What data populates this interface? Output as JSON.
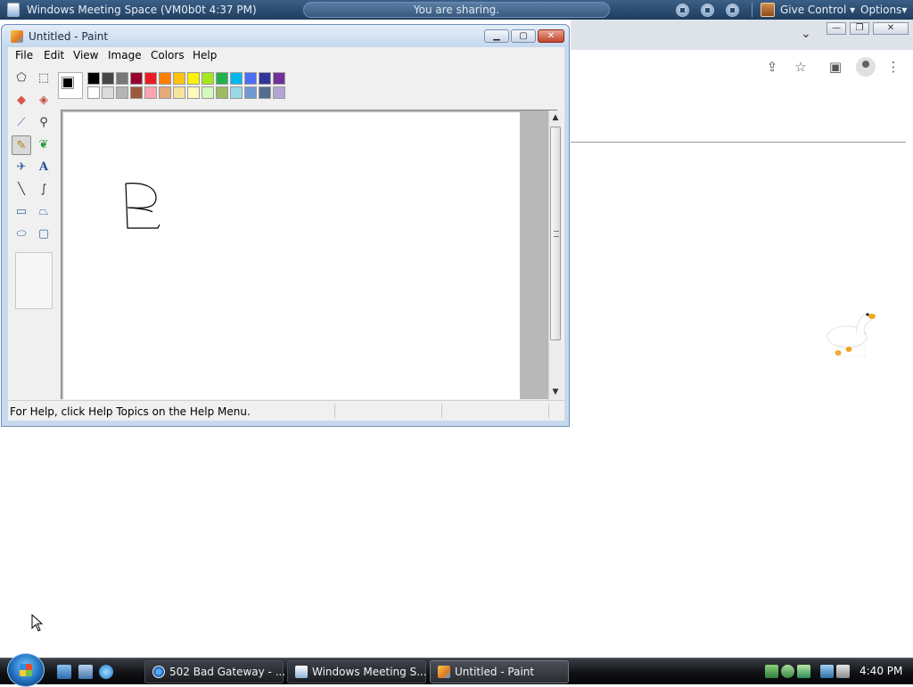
{
  "meeting_bar": {
    "title": "Windows Meeting Space (VM0b0t 4:37 PM)",
    "status": "You are sharing.",
    "give_control_label": "Give Control",
    "options_label": "Options"
  },
  "paint": {
    "title": "Untitled - Paint",
    "menu": [
      "File",
      "Edit",
      "View",
      "Image",
      "Colors",
      "Help"
    ],
    "status_text": "For Help, click Help Topics on the Help Menu.",
    "drawing_text": "B",
    "foreground_color": "#000000",
    "background_color": "#ffffff",
    "palette_row1": [
      "#000000",
      "#464646",
      "#787878",
      "#990030",
      "#ed1c24",
      "#ff7e00",
      "#ffc20e",
      "#fff200",
      "#a8e61d",
      "#22b14c",
      "#00b7ef",
      "#4d6df3",
      "#2f3699",
      "#6f3198"
    ],
    "palette_row2": [
      "#ffffff",
      "#dcdcdc",
      "#b4b4b4",
      "#9c5a3c",
      "#ffa3b1",
      "#e5aa7a",
      "#f5e49c",
      "#fff9bd",
      "#d3f9bc",
      "#9dbb61",
      "#99d9ea",
      "#709ad1",
      "#546d8e",
      "#b5a5d5"
    ],
    "tools": [
      "free-select-icon",
      "rect-select-icon",
      "eraser-icon",
      "fill-icon",
      "color-picker-icon",
      "magnifier-icon",
      "pencil-icon",
      "brush-icon",
      "airbrush-icon",
      "text-icon",
      "line-icon",
      "curve-icon",
      "rectangle-icon",
      "polygon-icon",
      "ellipse-icon",
      "rounded-rect-icon"
    ],
    "selected_tool": "pencil-icon"
  },
  "taskbar": {
    "tasks": [
      {
        "label": "502 Bad Gateway - ..."
      },
      {
        "label": "Windows Meeting S..."
      },
      {
        "label": "Untitled - Paint"
      }
    ],
    "clock": "4:40 PM"
  }
}
